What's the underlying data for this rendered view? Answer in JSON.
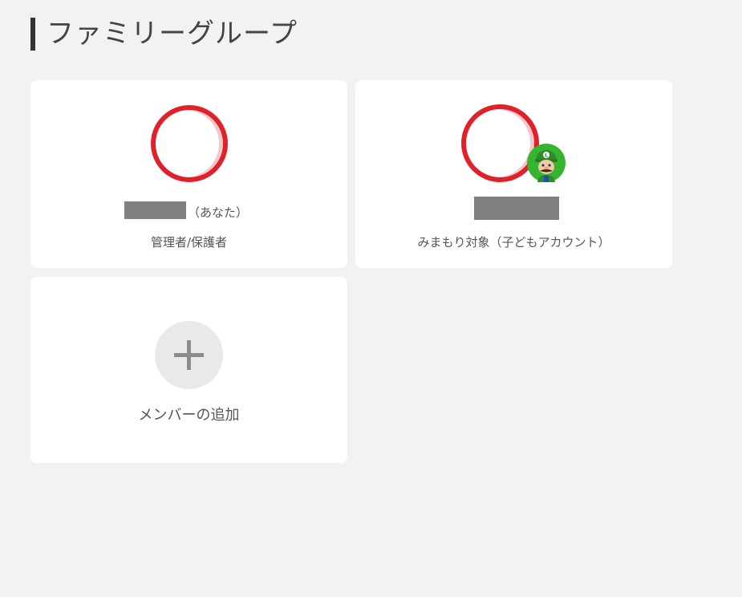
{
  "page": {
    "title": "ファミリーグループ"
  },
  "members": [
    {
      "you_label": "（あなた）",
      "role": "管理者/保護者"
    },
    {
      "role": "みまもり対象（子どもアカウント）"
    }
  ],
  "add_member": {
    "label": "メンバーの追加"
  },
  "icons": {
    "add": "plus-icon",
    "supervision": "luigi-avatar-icon"
  },
  "colors": {
    "background": "#f2f2f2",
    "card": "#ffffff",
    "avatar_ring": "#e0212a",
    "title_bar": "#333333",
    "text": "#555555",
    "redaction": "#808080"
  }
}
